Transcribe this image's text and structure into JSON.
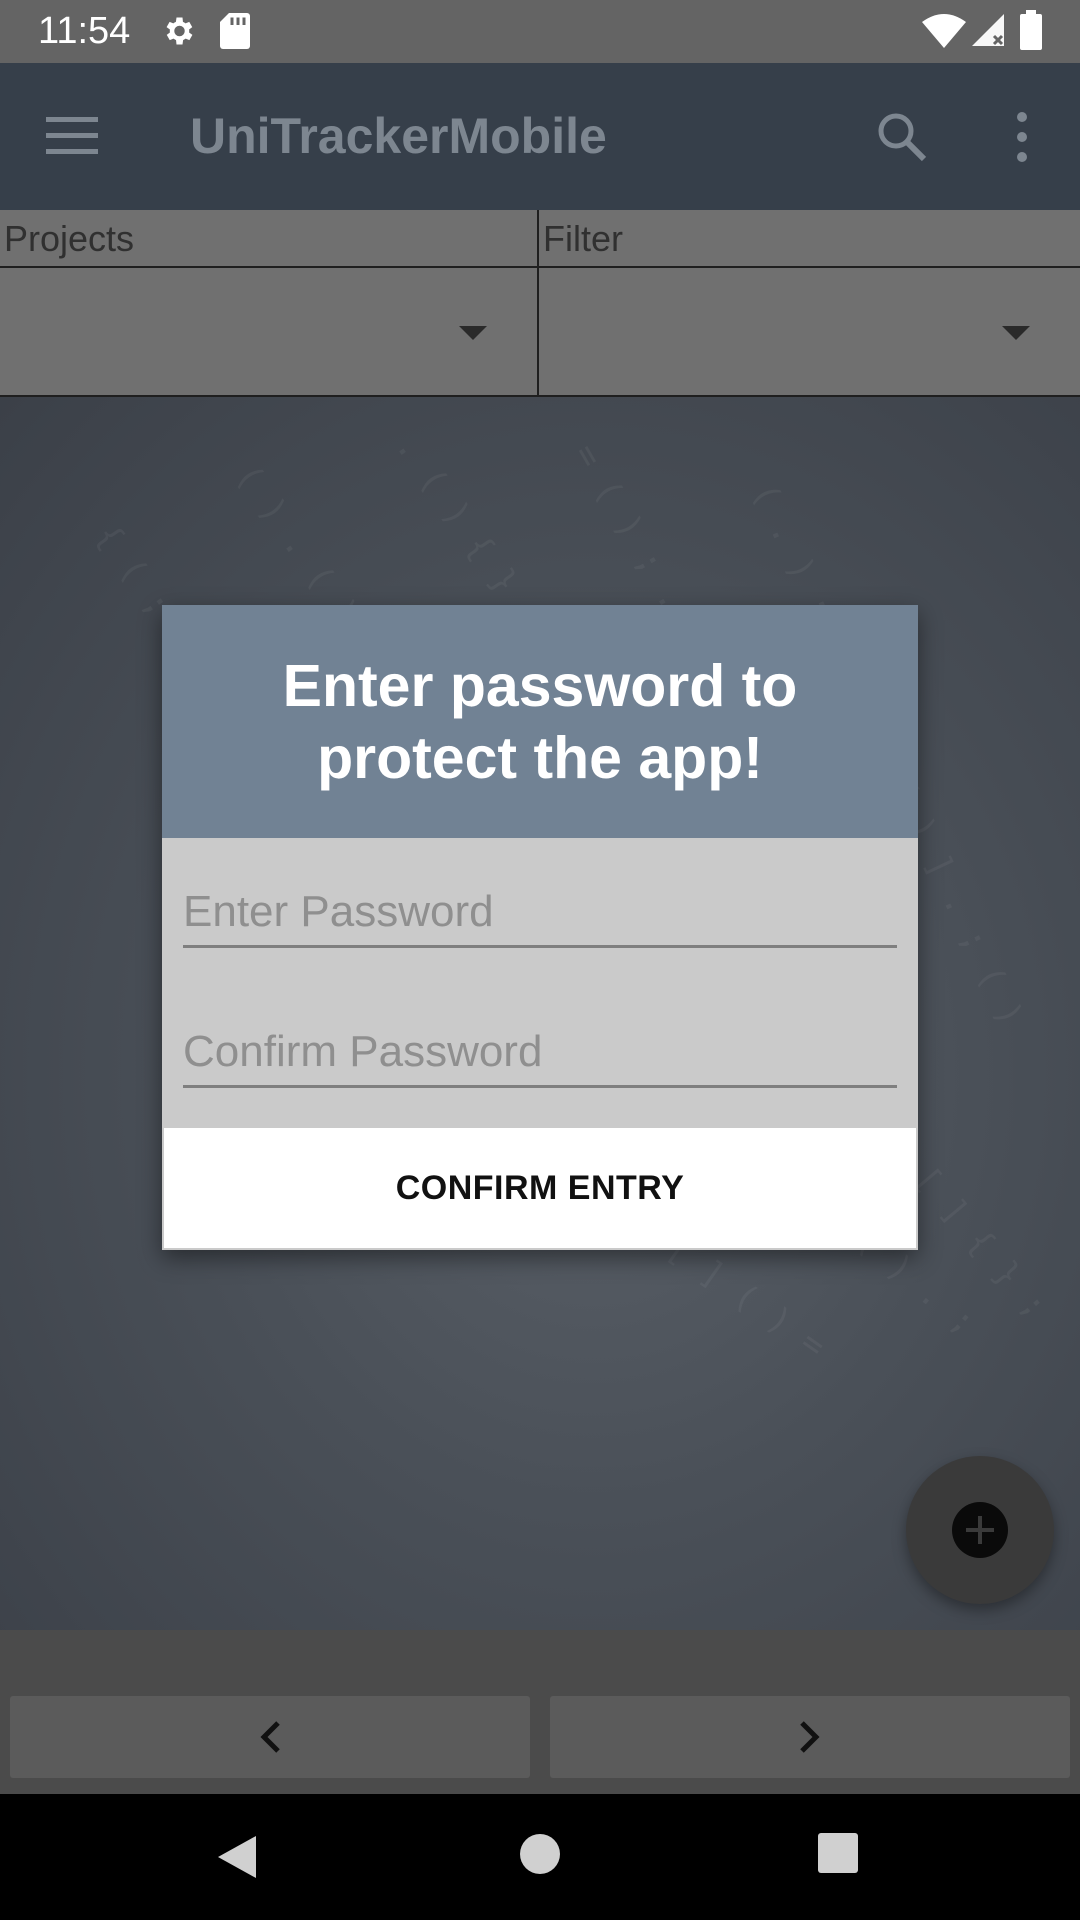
{
  "status_bar": {
    "time": "11:54",
    "icons": [
      "settings-icon",
      "sd-card-icon",
      "wifi-icon",
      "cell-signal-icon",
      "battery-icon"
    ]
  },
  "app_bar": {
    "title": "UniTrackerMobile",
    "icons": [
      "menu-icon",
      "search-icon",
      "more-vert-icon"
    ]
  },
  "spinners": {
    "projects_label": "Projects",
    "filter_label": "Filter",
    "projects_value": "",
    "filter_value": ""
  },
  "dialog": {
    "title": "Enter password to protect the app!",
    "password_placeholder": "Enter Password",
    "confirm_placeholder": "Confirm Password",
    "password_value": "",
    "confirm_value": "",
    "confirm_button_label": "CONFIRM ENTRY"
  },
  "fab": {
    "icon": "add-circle-icon"
  },
  "pager": {
    "prev_icon": "chevron-left-icon",
    "next_icon": "chevron-right-icon"
  },
  "nav_bar": {
    "icons": [
      "back-icon",
      "home-icon",
      "recents-icon"
    ]
  },
  "colors": {
    "status_bar": "#646464",
    "app_bar": "#363f4a",
    "dialog_header": "#718294",
    "dialog_body": "#cacaca",
    "scrim_content": "#4a5058"
  }
}
